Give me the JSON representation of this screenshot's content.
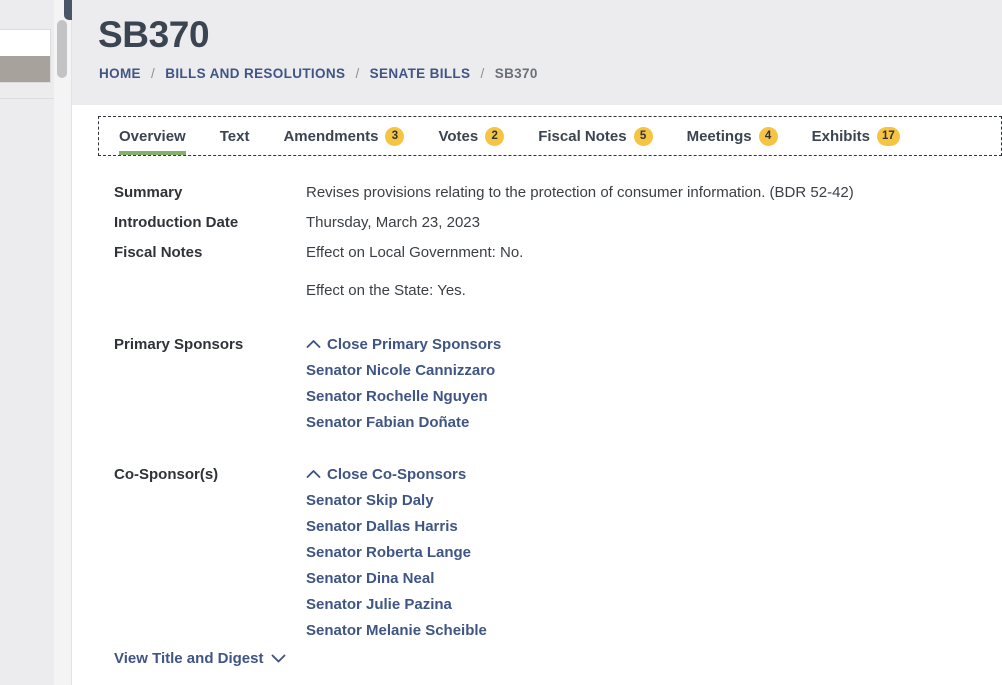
{
  "window": {
    "resize_handle_icon": "horizontal-resize-arrow-icon"
  },
  "header": {
    "title": "SB370",
    "breadcrumb": [
      {
        "label": "HOME",
        "is_link": true
      },
      {
        "label": "BILLS AND RESOLUTIONS",
        "is_link": true
      },
      {
        "label": "SENATE BILLS",
        "is_link": true
      },
      {
        "label": "SB370",
        "is_link": false
      }
    ],
    "separator": "/"
  },
  "tabs": [
    {
      "label": "Overview",
      "badge": "",
      "active": true
    },
    {
      "label": "Text",
      "badge": "",
      "active": false
    },
    {
      "label": "Amendments",
      "badge": "3",
      "active": false
    },
    {
      "label": "Votes",
      "badge": "2",
      "active": false
    },
    {
      "label": "Fiscal Notes",
      "badge": "5",
      "active": false
    },
    {
      "label": "Meetings",
      "badge": "4",
      "active": false
    },
    {
      "label": "Exhibits",
      "badge": "17",
      "active": false
    }
  ],
  "overview": {
    "summary_label": "Summary",
    "summary_value": "Revises provisions relating to the protection of consumer information. (BDR 52-42)",
    "introduction_date_label": "Introduction Date",
    "introduction_date_value": "Thursday, March 23, 2023",
    "fiscal_notes_label": "Fiscal Notes",
    "fiscal_notes_value_1": "Effect on Local Government: No.",
    "fiscal_notes_value_2": "Effect on the State: Yes.",
    "primary_sponsors_label": "Primary Sponsors",
    "primary_sponsors_toggle": "Close Primary Sponsors",
    "primary_sponsors": [
      "Senator Nicole Cannizzaro",
      "Senator Rochelle Nguyen",
      "Senator Fabian Doñate"
    ],
    "cosponsors_label": "Co-Sponsor(s)",
    "cosponsors_toggle": "Close Co-Sponsors",
    "cosponsors": [
      "Senator Skip Daly",
      "Senator Dallas Harris",
      "Senator Roberta Lange",
      "Senator Dina Neal",
      "Senator Julie Pazina",
      "Senator Melanie Scheible"
    ],
    "view_title_digest": "View Title and Digest"
  },
  "colors": {
    "accent_green": "#85b06b",
    "badge_yellow": "#f6c443",
    "link_navy": "#3f5584",
    "header_grey": "#ececee"
  }
}
